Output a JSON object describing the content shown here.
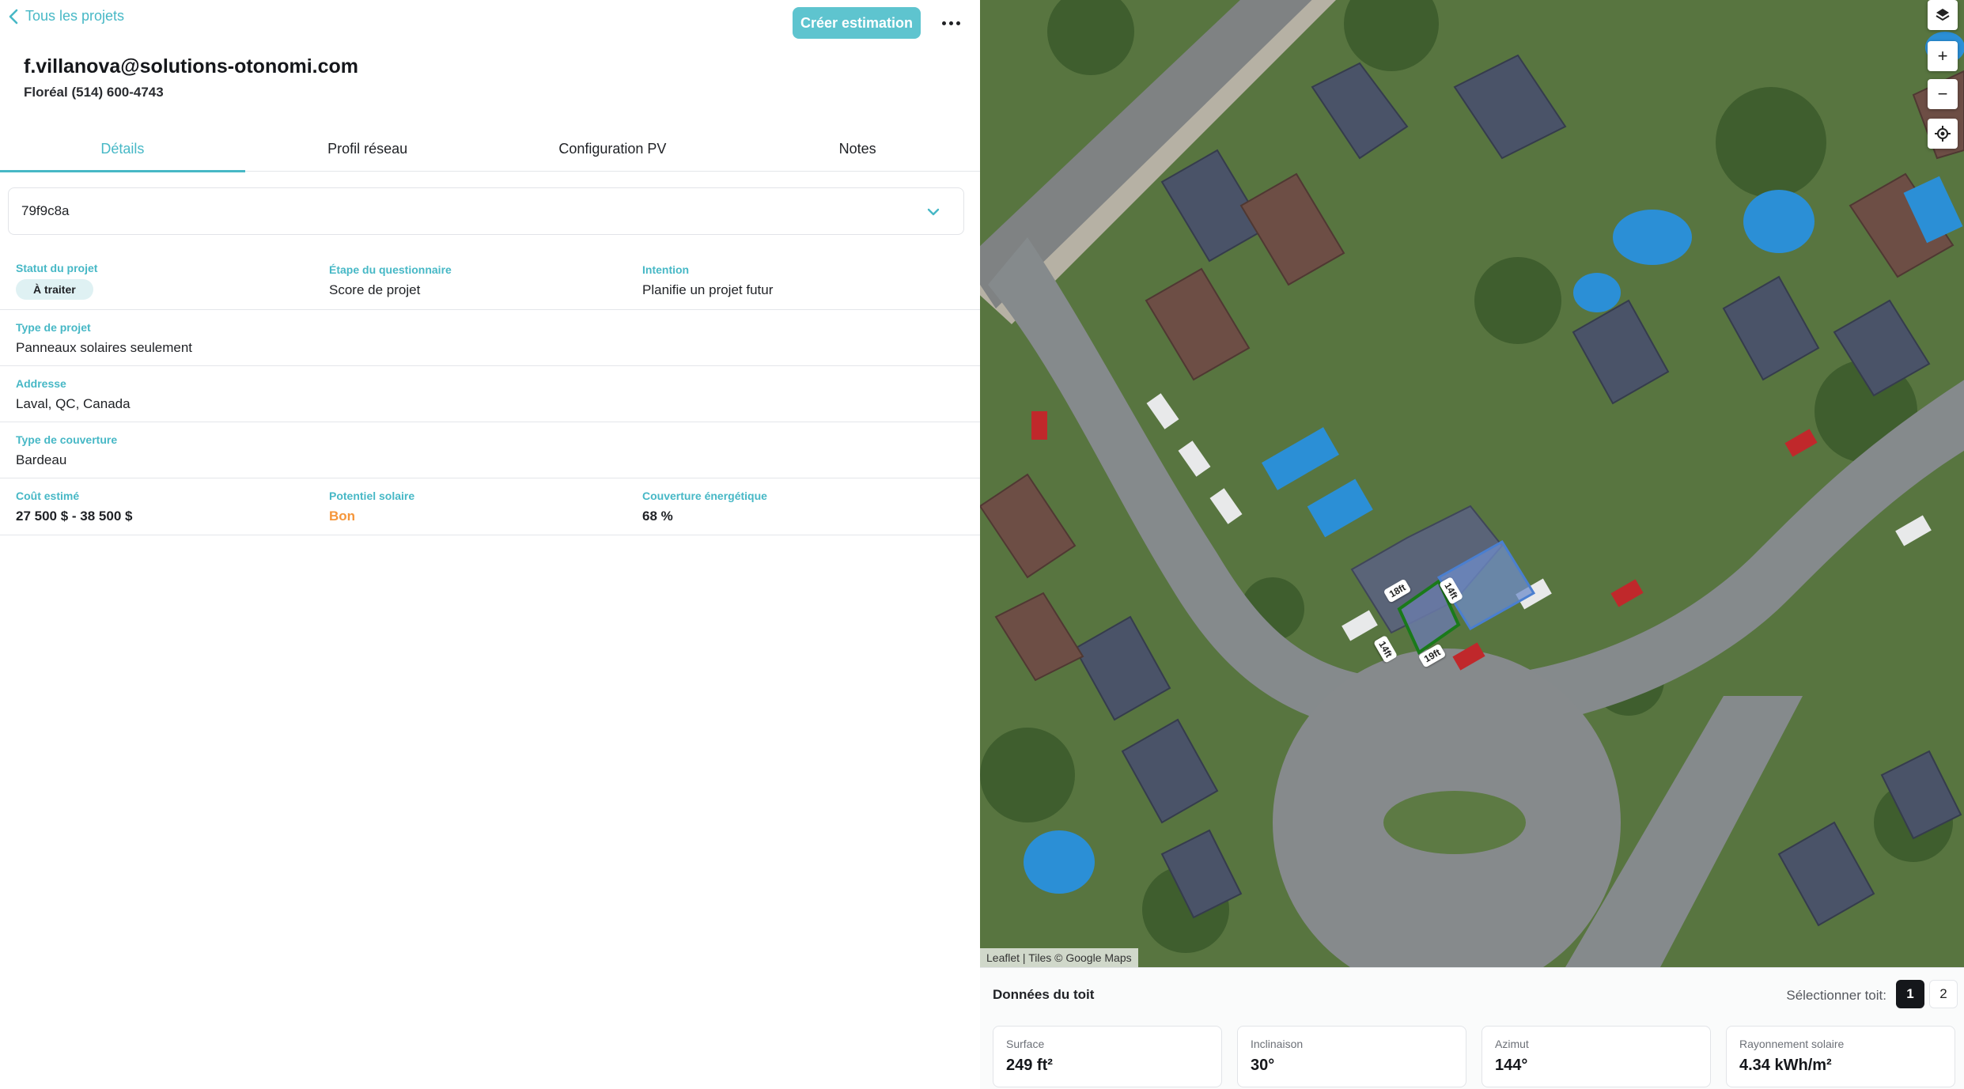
{
  "header": {
    "back_label": "Tous les projets",
    "create_button": "Créer estimation"
  },
  "contact": {
    "email": "f.villanova@solutions-otonomi.com",
    "subtitle": "Floréal (514) 600-4743"
  },
  "tabs": [
    {
      "label": "Détails",
      "active": true
    },
    {
      "label": "Profil réseau",
      "active": false
    },
    {
      "label": "Configuration PV",
      "active": false
    },
    {
      "label": "Notes",
      "active": false
    }
  ],
  "project_select": {
    "value": "79f9c8a"
  },
  "details": {
    "statut": {
      "label": "Statut du projet",
      "value": "À traiter"
    },
    "etape": {
      "label": "Étape du questionnaire",
      "value": "Score de projet"
    },
    "intention": {
      "label": "Intention",
      "value": "Planifie un projet futur"
    },
    "type_projet": {
      "label": "Type de projet",
      "value": "Panneaux solaires seulement"
    },
    "adresse": {
      "label": "Addresse",
      "value": "Laval, QC, Canada"
    },
    "couverture": {
      "label": "Type de couverture",
      "value": "Bardeau"
    },
    "cout": {
      "label": "Coût estimé",
      "value": "27 500 $ - 38 500 $"
    },
    "potentiel": {
      "label": "Potentiel solaire",
      "value": "Bon"
    },
    "energie": {
      "label": "Couverture énergétique",
      "value": "68 %"
    }
  },
  "map": {
    "attribution": "Leaflet | Tiles © Google Maps",
    "controls": {
      "zoom_in": "+",
      "zoom_out": "−"
    },
    "dimension_labels": [
      "18ft",
      "14ft",
      "14ft",
      "19ft"
    ],
    "colors": {
      "selected_roof": "#1a7a1a",
      "other_roof": "#4a7fd0"
    }
  },
  "roof_data": {
    "title": "Données du toit",
    "select_label": "Sélectionner toit:",
    "options": [
      "1",
      "2"
    ],
    "selected": "1",
    "stats": [
      {
        "label": "Surface",
        "value": "249 ft²"
      },
      {
        "label": "Inclinaison",
        "value": "30°"
      },
      {
        "label": "Azimut",
        "value": "144°"
      },
      {
        "label": "Rayonnement solaire",
        "value": "4.34 kWh/m²"
      }
    ]
  },
  "colors": {
    "accent": "#47b8c6",
    "button": "#5ec4cf",
    "warning": "#f5963b"
  }
}
